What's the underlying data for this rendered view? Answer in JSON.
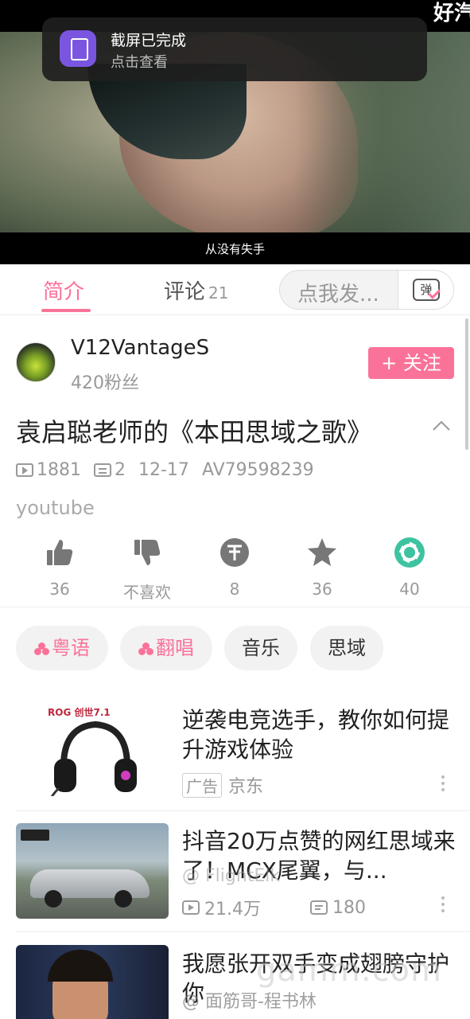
{
  "status_bar": {
    "corner_text": "好汽"
  },
  "notification": {
    "title": "截屏已完成",
    "subtitle": "点击查看"
  },
  "video": {
    "subtitle": "从没有失手"
  },
  "tabs": {
    "intro_label": "简介",
    "comments_label": "评论",
    "comments_count": "21",
    "danmaku_placeholder": "点我发...",
    "danmaku_icon_char": "弹"
  },
  "uploader": {
    "name": "V12VantageS",
    "fans": "420粉丝",
    "follow_label": "+ 关注"
  },
  "video_info": {
    "title": "袁启聪老师的《本田思域之歌》",
    "views": "1881",
    "danmaku_count": "2",
    "date": "12-17",
    "av_id": "AV79598239",
    "description": "youtube"
  },
  "actions": [
    {
      "icon": "thumbs-up-icon",
      "label": "36"
    },
    {
      "icon": "thumbs-down-icon",
      "label": "不喜欢"
    },
    {
      "icon": "coin-icon",
      "label": "8"
    },
    {
      "icon": "star-icon",
      "label": "36"
    },
    {
      "icon": "share-icon",
      "label": "40"
    }
  ],
  "tags": [
    {
      "label": "粤语",
      "highlight": true
    },
    {
      "label": "翻唱",
      "highlight": true
    },
    {
      "label": "音乐",
      "highlight": false
    },
    {
      "label": "思域",
      "highlight": false
    }
  ],
  "feed": [
    {
      "title": "逆袭电竞选手，教你如何提升游戏体验",
      "badge": "广告",
      "source": "京东",
      "thumb_brand": "ROG 创世7.1"
    },
    {
      "title": "抖音20万点赞的网红思域来了！MCX尾翼，与...",
      "views": "21.4万",
      "danmaku": "180",
      "overlay_text": "@ FlightElk"
    },
    {
      "title": "我愿张开双手变成翅膀守护你",
      "author_overlay": "@ 面筋哥-程书林"
    }
  ],
  "watermark": "gamm.com",
  "colors": {
    "accent": "#fb7299",
    "share": "#3dc3a0",
    "icon_gray": "#777777"
  }
}
